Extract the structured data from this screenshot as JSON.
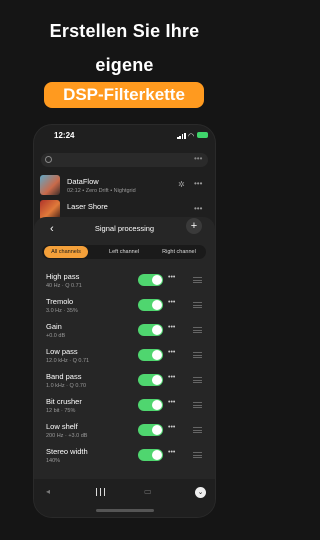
{
  "headline": {
    "line1": "Erstellen Sie Ihre",
    "line2": "eigene",
    "badge": "DSP-Filterkette"
  },
  "status_bar": {
    "time": "12:24"
  },
  "library": {
    "tracks": [
      {
        "title": "DataFlow",
        "meta": "02:12 • Zero Drift • Nightgrid"
      },
      {
        "title": "Laser Shore",
        "meta": ""
      }
    ]
  },
  "sheet": {
    "title": "Signal processing",
    "back_icon": "chevron-left-icon",
    "add_icon": "plus-icon",
    "tabs": [
      "All channels",
      "Left channel",
      "Right channel"
    ],
    "active_tab": 0,
    "effects": [
      {
        "name": "High pass",
        "params": "40 Hz · Q 0.71",
        "enabled": true
      },
      {
        "name": "Tremolo",
        "params": "3.0 Hz · 35%",
        "enabled": true
      },
      {
        "name": "Gain",
        "params": "+0.0 dB",
        "enabled": true
      },
      {
        "name": "Low pass",
        "params": "12.0 kHz · Q 0.71",
        "enabled": true
      },
      {
        "name": "Band pass",
        "params": "1.0 kHz · Q 0.70",
        "enabled": true
      },
      {
        "name": "Bit crusher",
        "params": "12 bit · 75%",
        "enabled": true
      },
      {
        "name": "Low shelf",
        "params": "200 Hz · +3.0 dB",
        "enabled": true
      },
      {
        "name": "Stereo width",
        "params": "140%",
        "enabled": true
      }
    ]
  },
  "colors": {
    "accent": "#ff9a1f",
    "toggle_on": "#4fd66f",
    "background": "#151515"
  }
}
